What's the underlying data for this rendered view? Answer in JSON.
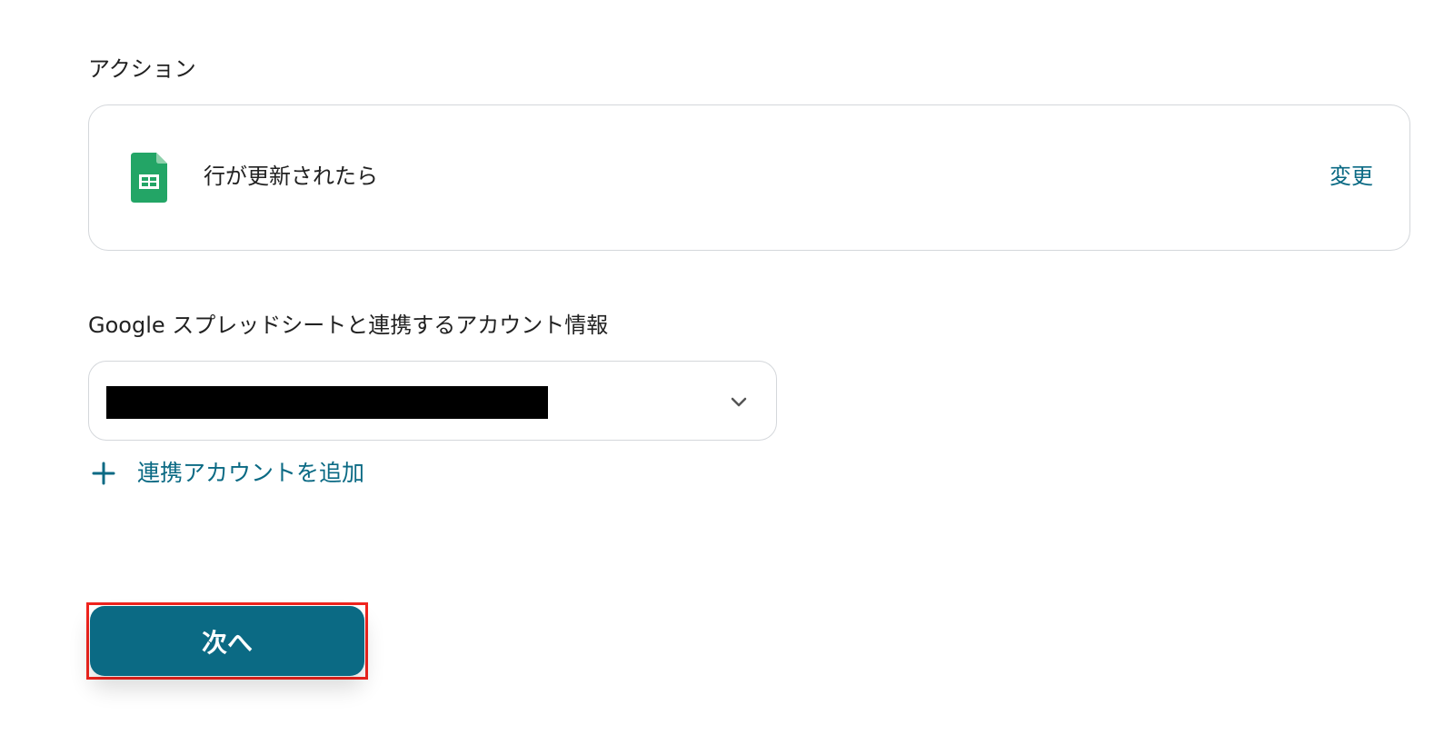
{
  "action_section": {
    "label": "アクション",
    "card": {
      "icon": "google-sheets-icon",
      "name": "行が更新されたら",
      "change_label": "変更"
    }
  },
  "account_section": {
    "label": "Google スプレッドシートと連携するアカウント情報",
    "select": {
      "value": "",
      "redacted": true,
      "icon": "chevron-down-icon"
    },
    "add_account_label": "連携アカウントを追加"
  },
  "footer": {
    "next_label": "次へ"
  },
  "colors": {
    "accent": "#0b6a84",
    "sheets_green": "#23a566",
    "border": "#d4d7db",
    "highlight": "#f0241e"
  }
}
